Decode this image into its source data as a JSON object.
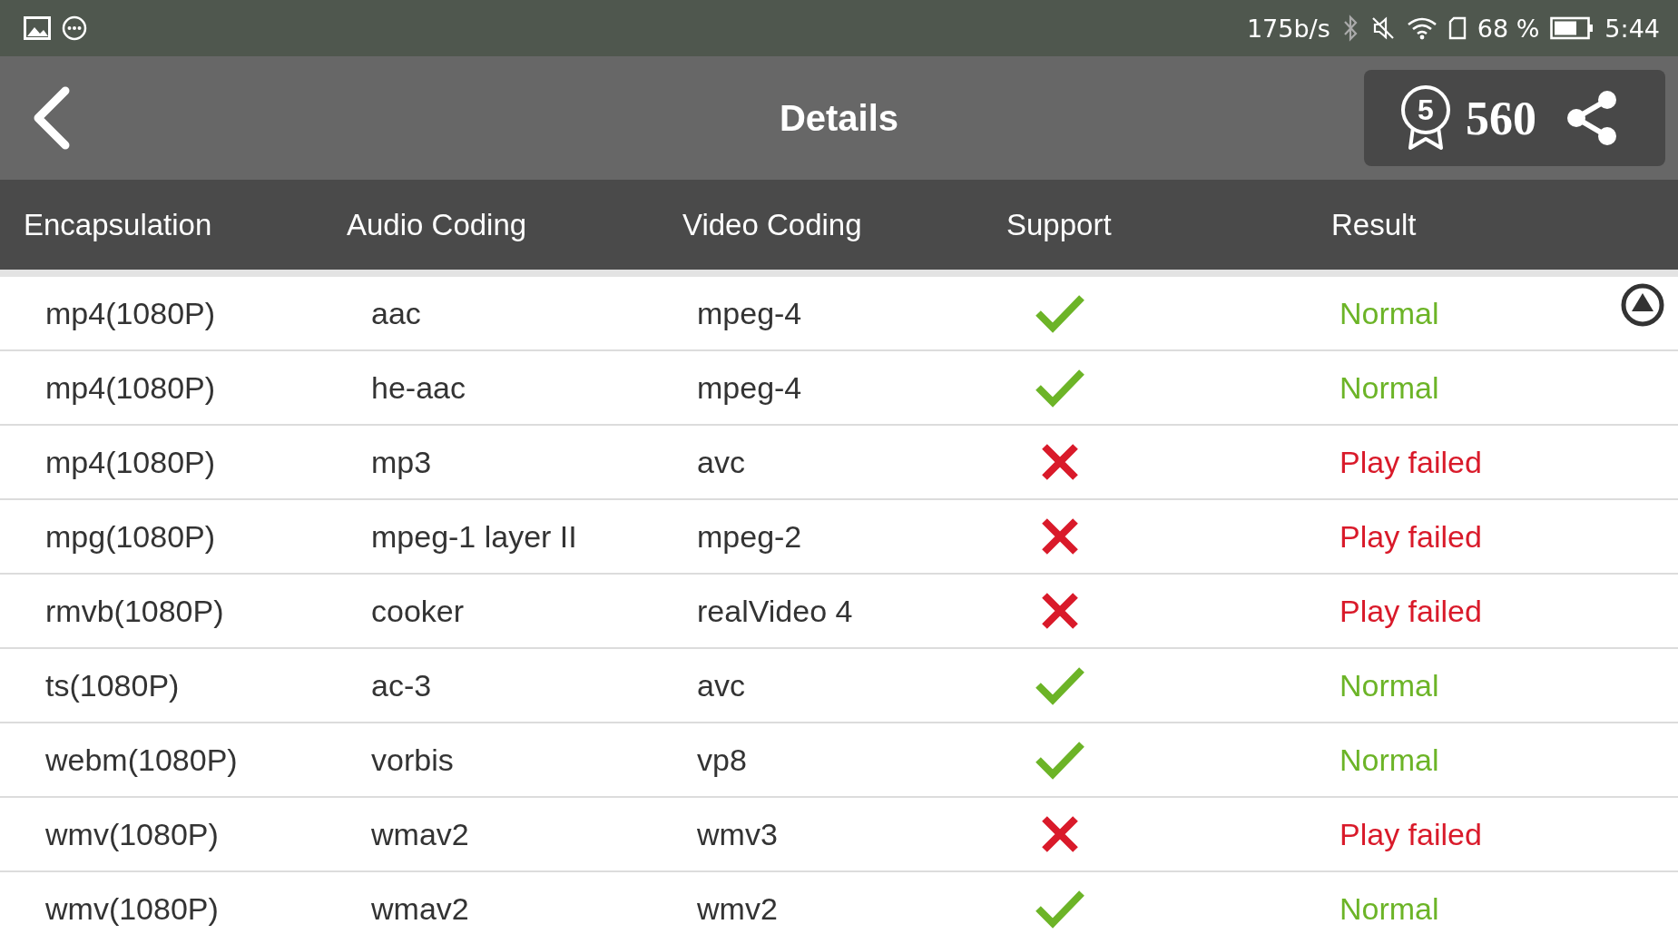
{
  "status_bar": {
    "speed": "175b/s",
    "battery_percent": "68 %",
    "time": "5:44"
  },
  "toolbar": {
    "title": "Details",
    "medal_number": "5",
    "points": "560"
  },
  "table": {
    "columns": [
      "Encapsulation",
      "Audio Coding",
      "Video Coding",
      "Support",
      "Result"
    ],
    "rows": [
      {
        "encapsulation": "mp4(1080P)",
        "audio": "aac",
        "video": "mpeg-4",
        "supported": true,
        "result": "Normal"
      },
      {
        "encapsulation": "mp4(1080P)",
        "audio": "he-aac",
        "video": "mpeg-4",
        "supported": true,
        "result": "Normal"
      },
      {
        "encapsulation": "mp4(1080P)",
        "audio": "mp3",
        "video": "avc",
        "supported": false,
        "result": "Play failed"
      },
      {
        "encapsulation": "mpg(1080P)",
        "audio": "mpeg-1 layer II",
        "video": "mpeg-2",
        "supported": false,
        "result": "Play failed"
      },
      {
        "encapsulation": "rmvb(1080P)",
        "audio": "cooker",
        "video": "realVideo 4",
        "supported": false,
        "result": "Play failed"
      },
      {
        "encapsulation": "ts(1080P)",
        "audio": "ac-3",
        "video": "avc",
        "supported": true,
        "result": "Normal"
      },
      {
        "encapsulation": "webm(1080P)",
        "audio": "vorbis",
        "video": "vp8",
        "supported": true,
        "result": "Normal"
      },
      {
        "encapsulation": "wmv(1080P)",
        "audio": "wmav2",
        "video": "wmv3",
        "supported": false,
        "result": "Play failed"
      },
      {
        "encapsulation": "wmv(1080P)",
        "audio": "wmav2",
        "video": "wmv2",
        "supported": true,
        "result": "Normal"
      }
    ]
  }
}
